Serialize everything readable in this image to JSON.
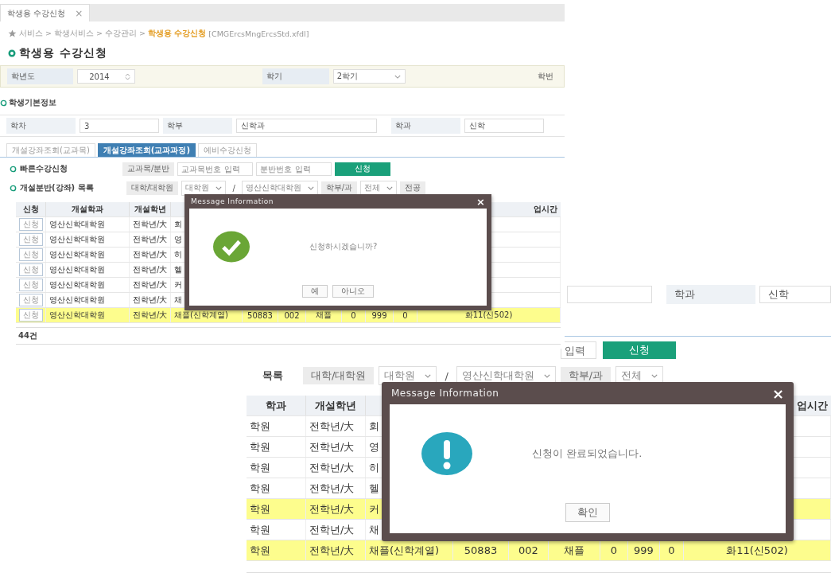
{
  "screenshot_1": {
    "tab": {
      "label": "학생용 수강신청",
      "close": "×"
    },
    "breadcrumb": {
      "path": "서비스 > 학생서비스 > 수강관리 > ",
      "current": "학생용 수강신청",
      "file": "[CMGErcsMngErcsStd.xfdl]"
    },
    "page_title": "학생용 수강신청",
    "search_fields": [
      {
        "label": "학년도",
        "value": "2014",
        "kind": "spinner"
      },
      {
        "label": "학기",
        "value": "2학기",
        "kind": "select"
      },
      {
        "label": "학번",
        "kind": "label_only"
      }
    ],
    "student_info": {
      "title": "학생기본정보",
      "fields": [
        {
          "label": "학차",
          "value": "3"
        },
        {
          "label": "학부",
          "value": "신학과"
        },
        {
          "label": "학과",
          "value": "신학"
        }
      ]
    },
    "tabs": [
      {
        "label": "개설강좌조회(교과목)",
        "selected": false
      },
      {
        "label": "개설강좌조회(교과과정)",
        "selected": true
      },
      {
        "label": "예비수강신청",
        "selected": false
      }
    ],
    "quick_apply": {
      "title": "빠른수강신청",
      "label": "교과목/분반",
      "inputs": [
        {
          "placeholder": "교과목번호 입력"
        },
        {
          "placeholder": "분반번호 입력"
        }
      ],
      "button": "신청"
    },
    "course_filter": {
      "title": "개설분반(강좌) 목록",
      "items": [
        {
          "kind": "label",
          "text": "대학/대학원"
        },
        {
          "kind": "select",
          "text": "대학원"
        },
        {
          "kind": "text",
          "text": "/"
        },
        {
          "kind": "select",
          "text": "영산신학대학원"
        },
        {
          "kind": "label",
          "text": "학부/과"
        },
        {
          "kind": "select",
          "text": "전체"
        },
        {
          "kind": "label",
          "text": "전공"
        }
      ]
    },
    "table": {
      "columns": [
        "신청",
        "개설학과",
        "개설학년"
      ],
      "last_column": "업시간",
      "rows": [
        {
          "cells": [
            "신청",
            "영산신학대학원",
            "전학년/大",
            "회"
          ],
          "highlighted": false
        },
        {
          "cells": [
            "신청",
            "영산신학대학원",
            "전학년/大",
            "영"
          ],
          "highlighted": false
        },
        {
          "cells": [
            "신청",
            "영산신학대학원",
            "전학년/大",
            "히"
          ],
          "highlighted": false
        },
        {
          "cells": [
            "신청",
            "영산신학대학원",
            "전학년/大",
            "헬"
          ],
          "highlighted": false
        },
        {
          "cells": [
            "신청",
            "영산신학대학원",
            "전학년/大",
            "커"
          ],
          "highlighted": false
        },
        {
          "cells": [
            "신청",
            "영산신학대학원",
            "전학년/大",
            "채"
          ],
          "highlighted": false
        },
        {
          "cells": [
            "신청",
            "영산신학대학원",
            "전학년/大",
            "채플(신학계열)",
            "50883",
            "002",
            "채플",
            "0",
            "999",
            "0",
            "화11(신502)"
          ],
          "highlighted": true
        }
      ],
      "count": "44건"
    },
    "dialog": {
      "title": "Message Information",
      "close": "×",
      "kind": "confirm",
      "message": "신청하시겠습니까?",
      "buttons": [
        "예",
        "아니오"
      ]
    }
  },
  "screenshot_2": {
    "student_info": {
      "fields": [
        {
          "label": "학과",
          "value": "신학"
        }
      ]
    },
    "quick_apply": {
      "input_placeholder": "입력",
      "button": "신청"
    },
    "course_filter": {
      "title": "목록",
      "items": [
        {
          "kind": "label",
          "text": "대학/대학원"
        },
        {
          "kind": "select",
          "text": "대학원"
        },
        {
          "kind": "text",
          "text": "/"
        },
        {
          "kind": "select",
          "text": "영산신학대학원"
        },
        {
          "kind": "label",
          "text": "학부/과"
        },
        {
          "kind": "select",
          "text": "전체"
        }
      ]
    },
    "table": {
      "columns": [
        "학과",
        "개설학년"
      ],
      "last_column": "업시간",
      "rows": [
        {
          "cells": [
            "학원",
            "전학년/大",
            "회"
          ],
          "highlighted": false
        },
        {
          "cells": [
            "학원",
            "전학년/大",
            "영"
          ],
          "highlighted": false
        },
        {
          "cells": [
            "학원",
            "전학년/大",
            "히"
          ],
          "highlighted": false
        },
        {
          "cells": [
            "학원",
            "전학년/大",
            "헬"
          ],
          "highlighted": false
        },
        {
          "cells": [
            "학원",
            "전학년/大",
            "커"
          ],
          "highlighted": true
        },
        {
          "cells": [
            "학원",
            "전학년/大",
            "채"
          ],
          "highlighted": false
        },
        {
          "cells": [
            "학원",
            "전학년/大",
            "채플(신학계열)",
            "50883",
            "002",
            "채플",
            "0",
            "999",
            "0",
            "화11(신502)"
          ],
          "highlighted": true
        }
      ]
    },
    "dialog": {
      "title": "Message Information",
      "close": "×",
      "kind": "notice",
      "message": "신청이 완료되었습니다.",
      "buttons": [
        "확인"
      ]
    }
  }
}
